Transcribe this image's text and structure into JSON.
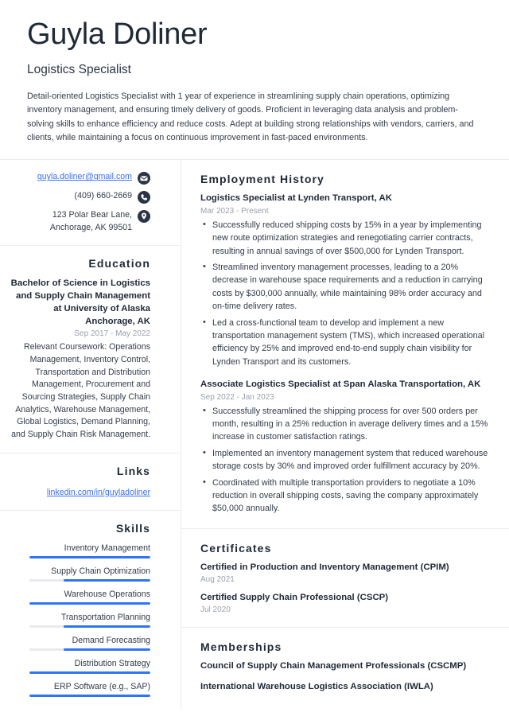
{
  "colors": {
    "accent_blue": "#2f74f5",
    "link_blue": "#3a6ff7",
    "heading_navy": "#1f2937",
    "body_text": "#333c4a",
    "muted_date": "#9aa1ab",
    "divider": "#e9ebee",
    "skill_track": "#e8eaed",
    "icon_navy": "#2b3445"
  },
  "header": {
    "name": "Guyla Doliner",
    "job_title": "Logistics Specialist",
    "summary": "Detail-oriented Logistics Specialist with 1 year of experience in streamlining supply chain operations, optimizing inventory management, and ensuring timely delivery of goods. Proficient in leveraging data analysis and problem-solving skills to enhance efficiency and reduce costs. Adept at building strong relationships with vendors, carriers, and clients, while maintaining a focus on continuous improvement in fast-paced environments."
  },
  "contact": {
    "items": [
      {
        "icon": "envelope-icon",
        "text": "guyla.doliner@gmail.com",
        "is_link": true
      },
      {
        "icon": "phone-icon",
        "text": "(409) 660-2669",
        "is_link": false
      },
      {
        "icon": "location-pin-icon",
        "text": "123 Polar Bear Lane, Anchorage, AK 99501",
        "is_link": false
      }
    ]
  },
  "education": {
    "title": "Education",
    "degree": "Bachelor of Science in Logistics and Supply Chain Management at University of Alaska Anchorage, AK",
    "date": "Sep 2017 - May 2022",
    "description": "Relevant Coursework: Operations Management, Inventory Control, Transportation and Distribution Management, Procurement and Sourcing Strategies, Supply Chain Analytics, Warehouse Management, Global Logistics, Demand Planning, and Supply Chain Risk Management."
  },
  "links": {
    "title": "Links",
    "items": [
      {
        "label": "linkedin.com/in/guyladoliner"
      }
    ]
  },
  "skills": {
    "title": "Skills",
    "items": [
      {
        "name": "Inventory Management",
        "level": 100
      },
      {
        "name": "Supply Chain Optimization",
        "level": 72
      },
      {
        "name": "Warehouse Operations",
        "level": 100
      },
      {
        "name": "Transportation Planning",
        "level": 72
      },
      {
        "name": "Demand Forecasting",
        "level": 72
      },
      {
        "name": "Distribution Strategy",
        "level": 100
      },
      {
        "name": "ERP Software (e.g., SAP)",
        "level": 100
      }
    ]
  },
  "employment": {
    "title": "Employment History",
    "jobs": [
      {
        "heading": "Logistics Specialist at Lynden Transport, AK",
        "date": "Mar 2023 - Present",
        "bullets": [
          "Successfully reduced shipping costs by 15% in a year by implementing new route optimization strategies and renegotiating carrier contracts, resulting in annual savings of over $500,000 for Lynden Transport.",
          "Streamlined inventory management processes, leading to a 20% decrease in warehouse space requirements and a reduction in carrying costs by $300,000 annually, while maintaining 98% order accuracy and on-time delivery rates.",
          "Led a cross-functional team to develop and implement a new transportation management system (TMS), which increased operational efficiency by 25% and improved end-to-end supply chain visibility for Lynden Transport and its customers."
        ]
      },
      {
        "heading": "Associate Logistics Specialist at Span Alaska Transportation, AK",
        "date": "Sep 2022 - Jan 2023",
        "bullets": [
          "Successfully streamlined the shipping process for over 500 orders per month, resulting in a 25% reduction in average delivery times and a 15% increase in customer satisfaction ratings.",
          "Implemented an inventory management system that reduced warehouse storage costs by 30% and improved order fulfillment accuracy by 20%.",
          "Coordinated with multiple transportation providers to negotiate a 10% reduction in overall shipping costs, saving the company approximately $50,000 annually."
        ]
      }
    ]
  },
  "certificates": {
    "title": "Certificates",
    "items": [
      {
        "title": "Certified in Production and Inventory Management (CPIM)",
        "date": "Aug 2021"
      },
      {
        "title": "Certified Supply Chain Professional (CSCP)",
        "date": "Jul 2020"
      }
    ]
  },
  "memberships": {
    "title": "Memberships",
    "items": [
      {
        "title": "Council of Supply Chain Management Professionals (CSCMP)",
        "date": ""
      },
      {
        "title": "International Warehouse Logistics Association (IWLA)",
        "date": ""
      }
    ]
  }
}
